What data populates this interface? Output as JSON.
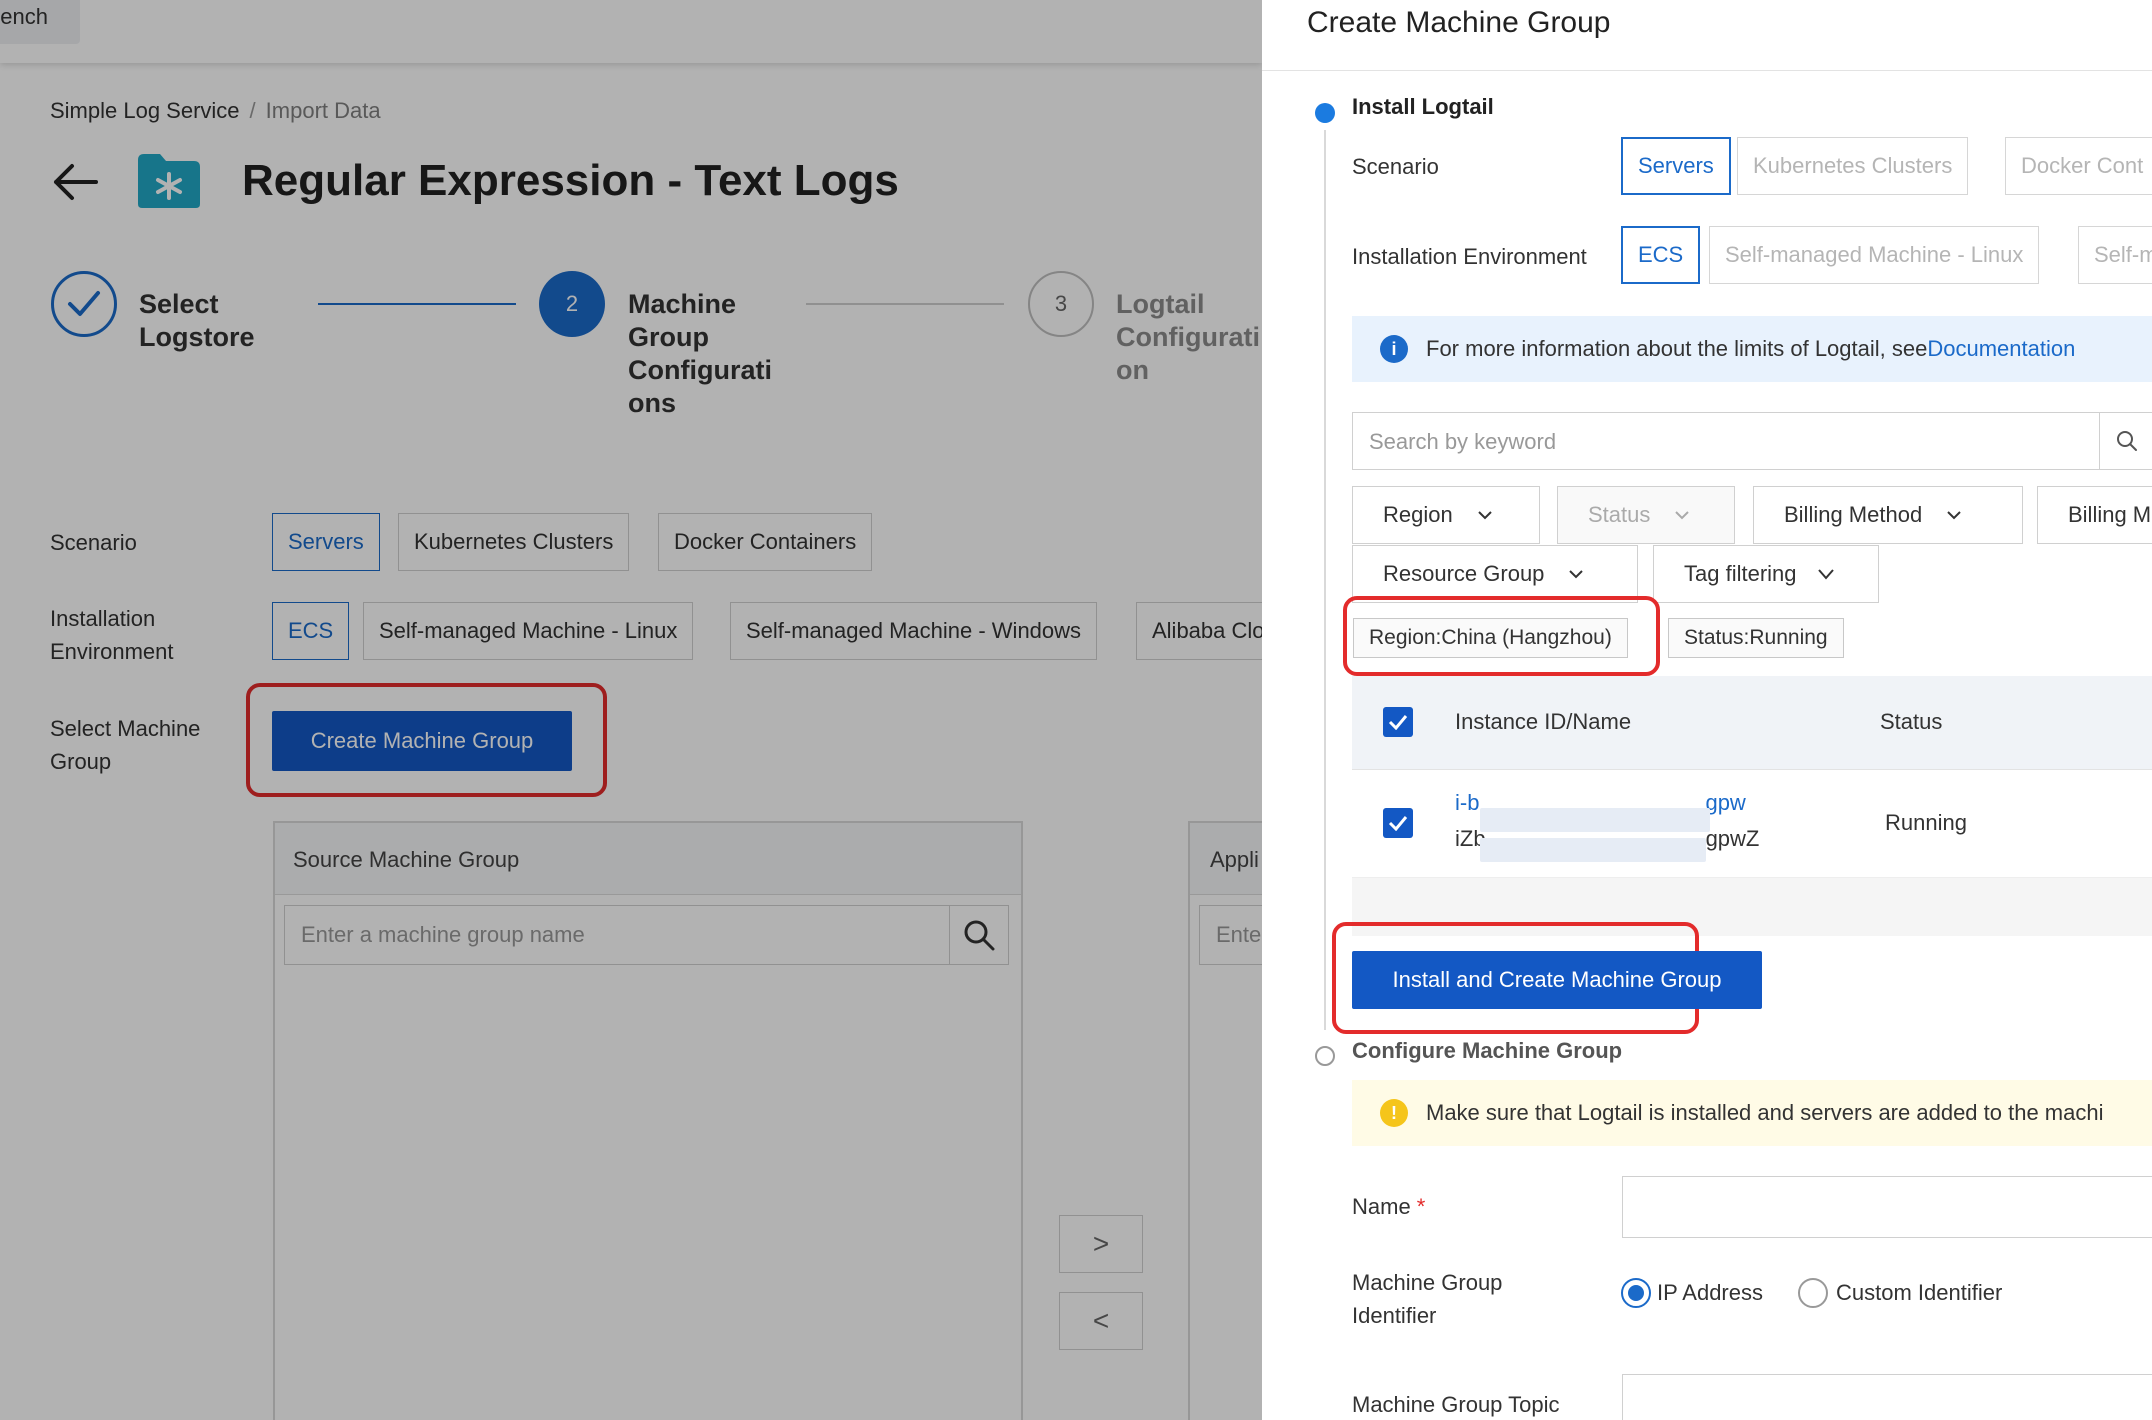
{
  "background_page": {
    "top_tab_label": "bench",
    "breadcrumb": {
      "root": "Simple Log Service",
      "separator": "/",
      "current": "Import Data"
    },
    "title": "Regular Expression - Text Logs",
    "steps": [
      {
        "number": "",
        "label": "Select\nLogstore",
        "status": "done"
      },
      {
        "number": "2",
        "label": "Machine\nGroup\nConfigurati\nons",
        "status": "active"
      },
      {
        "number": "3",
        "label": "Logtail\nConfigurati\non",
        "status": "todo"
      }
    ],
    "scenario": {
      "label": "Scenario",
      "options": [
        "Servers",
        "Kubernetes Clusters",
        "Docker Containers"
      ],
      "selected": "Servers"
    },
    "installation_environment": {
      "label": "Installation\nEnvironment",
      "options": [
        "ECS",
        "Self-managed Machine - Linux",
        "Self-managed Machine - Windows",
        "Alibaba Clo"
      ],
      "selected": "ECS"
    },
    "select_machine_group": {
      "label": "Select Machine\nGroup",
      "button": "Create Machine Group"
    },
    "source_panel": {
      "title": "Source Machine Group",
      "placeholder": "Enter a machine group name"
    },
    "applied_panel": {
      "title": "Appli",
      "placeholder": "Ente"
    },
    "transfer_buttons": {
      "right": ">",
      "left": "<"
    }
  },
  "drawer": {
    "title": "Create Machine Group",
    "install_section": {
      "title": "Install Logtail",
      "scenario": {
        "label": "Scenario",
        "options": [
          "Servers",
          "Kubernetes Clusters",
          "Docker Cont"
        ],
        "selected": "Servers"
      },
      "installation_environment": {
        "label": "Installation Environment",
        "options": [
          "ECS",
          "Self-managed Machine - Linux",
          "Self-m"
        ],
        "selected": "ECS"
      },
      "info": {
        "text": "For more information about the limits of Logtail, see",
        "link": "Documentation"
      },
      "search_placeholder": "Search by keyword",
      "filters": [
        "Region",
        "Status",
        "Billing Method",
        "Billing M",
        "Resource Group",
        "Tag filtering"
      ],
      "active_tags": [
        "Region:China (Hangzhou)",
        "Status:Running"
      ],
      "table": {
        "columns": [
          "Instance ID/Name",
          "Status"
        ],
        "rows": [
          {
            "id_prefix": "i-b",
            "id_suffix": "gpw",
            "name_prefix": "iZb",
            "name_suffix": "gpwZ",
            "status": "Running"
          }
        ]
      },
      "install_button": "Install and Create Machine Group"
    },
    "configure_section": {
      "title": "Configure Machine Group",
      "warning": "Make sure that Logtail is installed and servers are added to the machi",
      "name_label": "Name",
      "required_mark": "*",
      "identifier_label": "Machine Group\nIdentifier",
      "identifier_options": [
        "IP Address",
        "Custom Identifier"
      ],
      "identifier_selected": "IP Address",
      "topic_label": "Machine Group Topic"
    }
  },
  "colors": {
    "primary": "#1358c4",
    "link": "#1b6ac9",
    "highlight_box": "#e32b2b",
    "info_bg": "#e8f2fd",
    "warn_bg": "#fffbe6"
  }
}
